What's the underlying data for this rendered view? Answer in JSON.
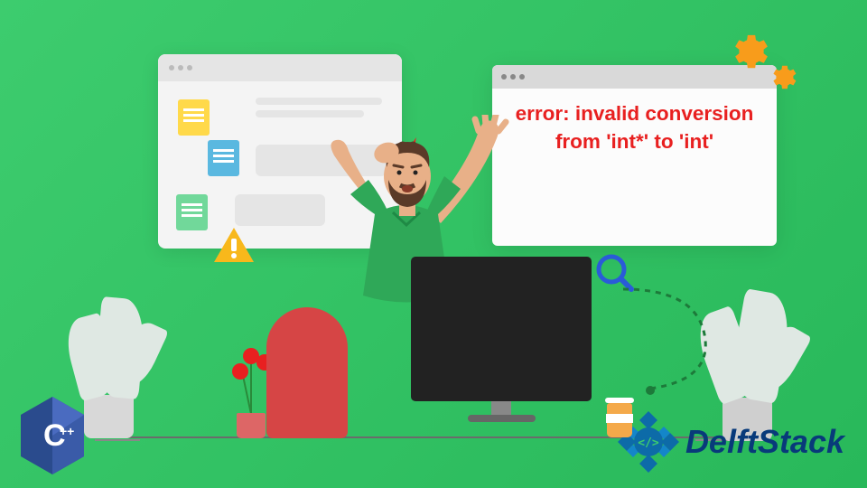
{
  "error_message": "error: invalid conversion from 'int*' to 'int'",
  "brand": {
    "name": "DelftStack",
    "language_badge": "C++"
  },
  "colors": {
    "background": "#3dcc6e",
    "error_text": "#e82020",
    "accent_orange": "#f89c1b",
    "brand_blue": "#083a7a"
  },
  "icons": {
    "warning": "warning-triangle",
    "gear": "gear",
    "magnifier": "magnifying-glass",
    "lightning": "lightning-bolt"
  }
}
